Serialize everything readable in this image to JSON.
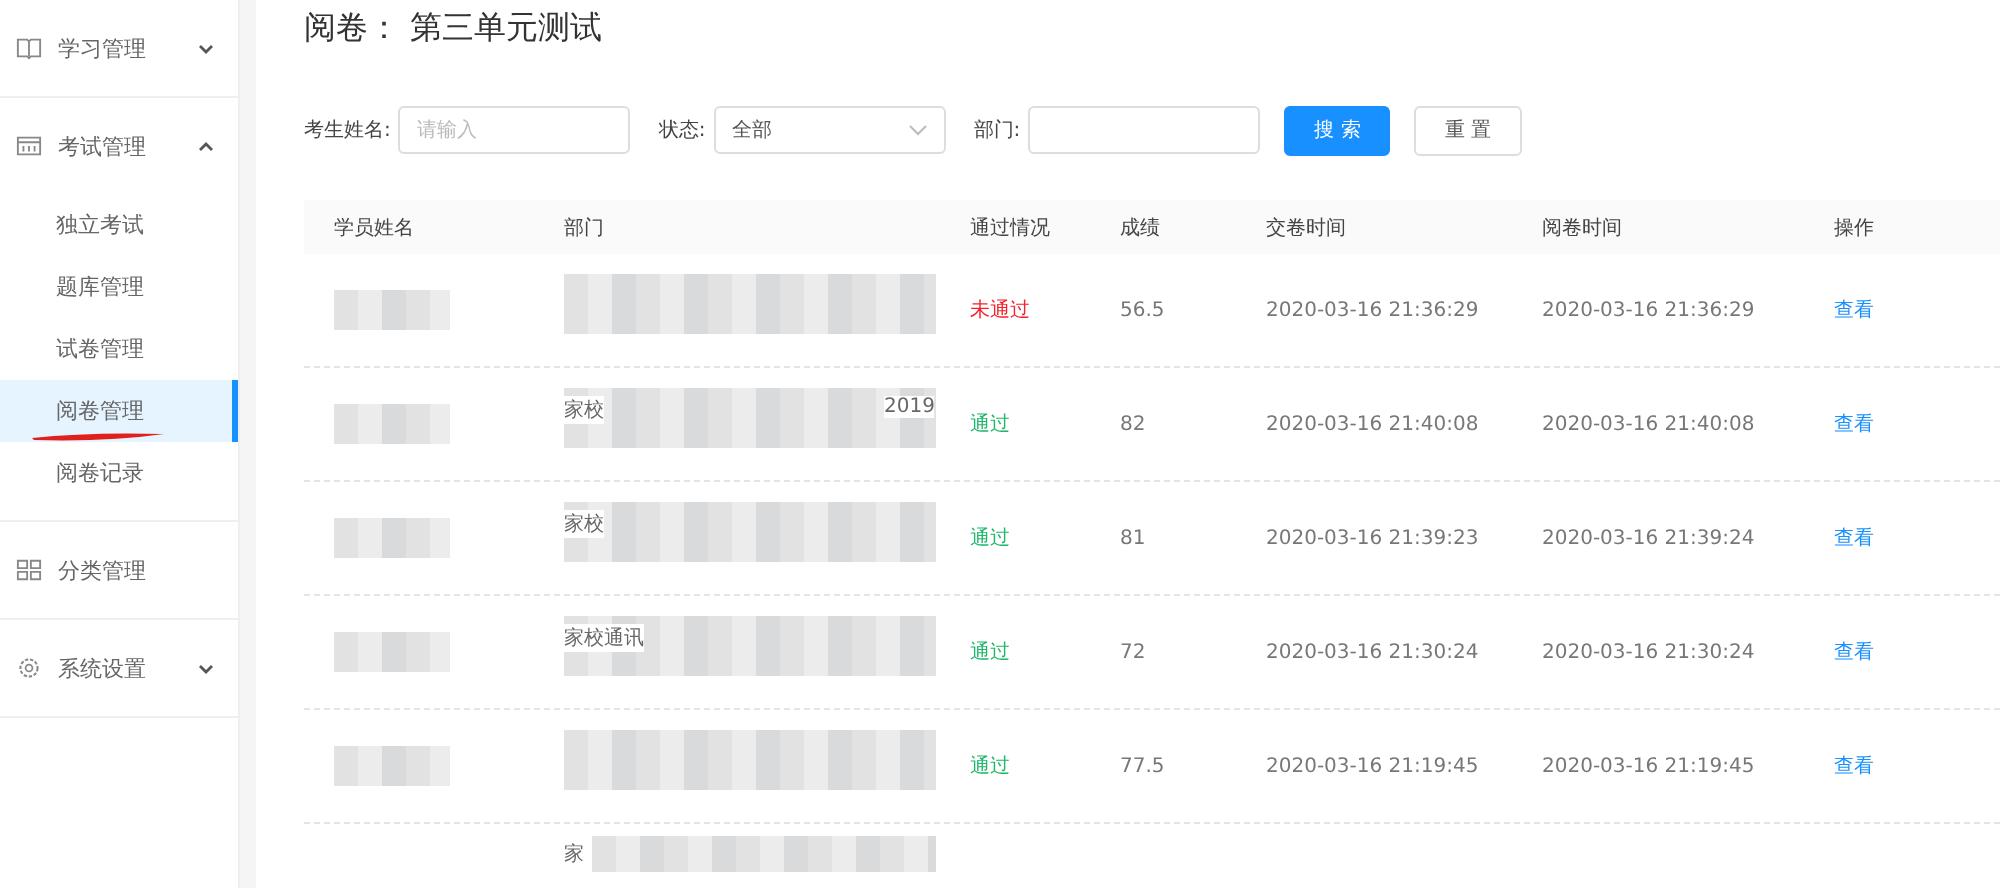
{
  "sidebar": {
    "items": [
      {
        "label": "学习管理",
        "expanded": false
      },
      {
        "label": "考试管理",
        "expanded": true,
        "children": [
          {
            "label": "独立考试",
            "selected": false
          },
          {
            "label": "题库管理",
            "selected": false
          },
          {
            "label": "试卷管理",
            "selected": false
          },
          {
            "label": "阅卷管理",
            "selected": true
          },
          {
            "label": "阅卷记录",
            "selected": false
          }
        ]
      },
      {
        "label": "分类管理"
      },
      {
        "label": "系统设置",
        "expanded": false
      }
    ]
  },
  "page_title": "阅卷： 第三单元测试",
  "filters": {
    "name_label": "考生姓名:",
    "name_placeholder": "请输入",
    "status_label": "状态:",
    "status_value": "全部",
    "dept_label": "部门:",
    "search_button": "搜 索",
    "reset_button": "重 置"
  },
  "table": {
    "columns": [
      "学员姓名",
      "部门",
      "通过情况",
      "成绩",
      "交卷时间",
      "阅卷时间",
      "操作"
    ],
    "rows": [
      {
        "department_fragments": [],
        "passed": false,
        "result": "未通过",
        "score": "56.5",
        "submitted": "2020-03-16 21:36:29",
        "reviewed": "2020-03-16 21:36:29",
        "action": "查看"
      },
      {
        "department_fragments": [
          "家校",
          "2019"
        ],
        "passed": true,
        "result": "通过",
        "score": "82",
        "submitted": "2020-03-16 21:40:08",
        "reviewed": "2020-03-16 21:40:08",
        "action": "查看"
      },
      {
        "department_fragments": [
          "家校"
        ],
        "passed": true,
        "result": "通过",
        "score": "81",
        "submitted": "2020-03-16 21:39:23",
        "reviewed": "2020-03-16 21:39:24",
        "action": "查看"
      },
      {
        "department_fragments": [
          "家校通讯"
        ],
        "passed": true,
        "result": "通过",
        "score": "72",
        "submitted": "2020-03-16 21:30:24",
        "reviewed": "2020-03-16 21:30:24",
        "action": "查看"
      },
      {
        "department_fragments": [],
        "passed": true,
        "result": "通过",
        "score": "77.5",
        "submitted": "2020-03-16 21:19:45",
        "reviewed": "2020-03-16 21:19:45",
        "action": "查看"
      },
      {
        "department_fragments": [
          "家"
        ]
      }
    ]
  }
}
